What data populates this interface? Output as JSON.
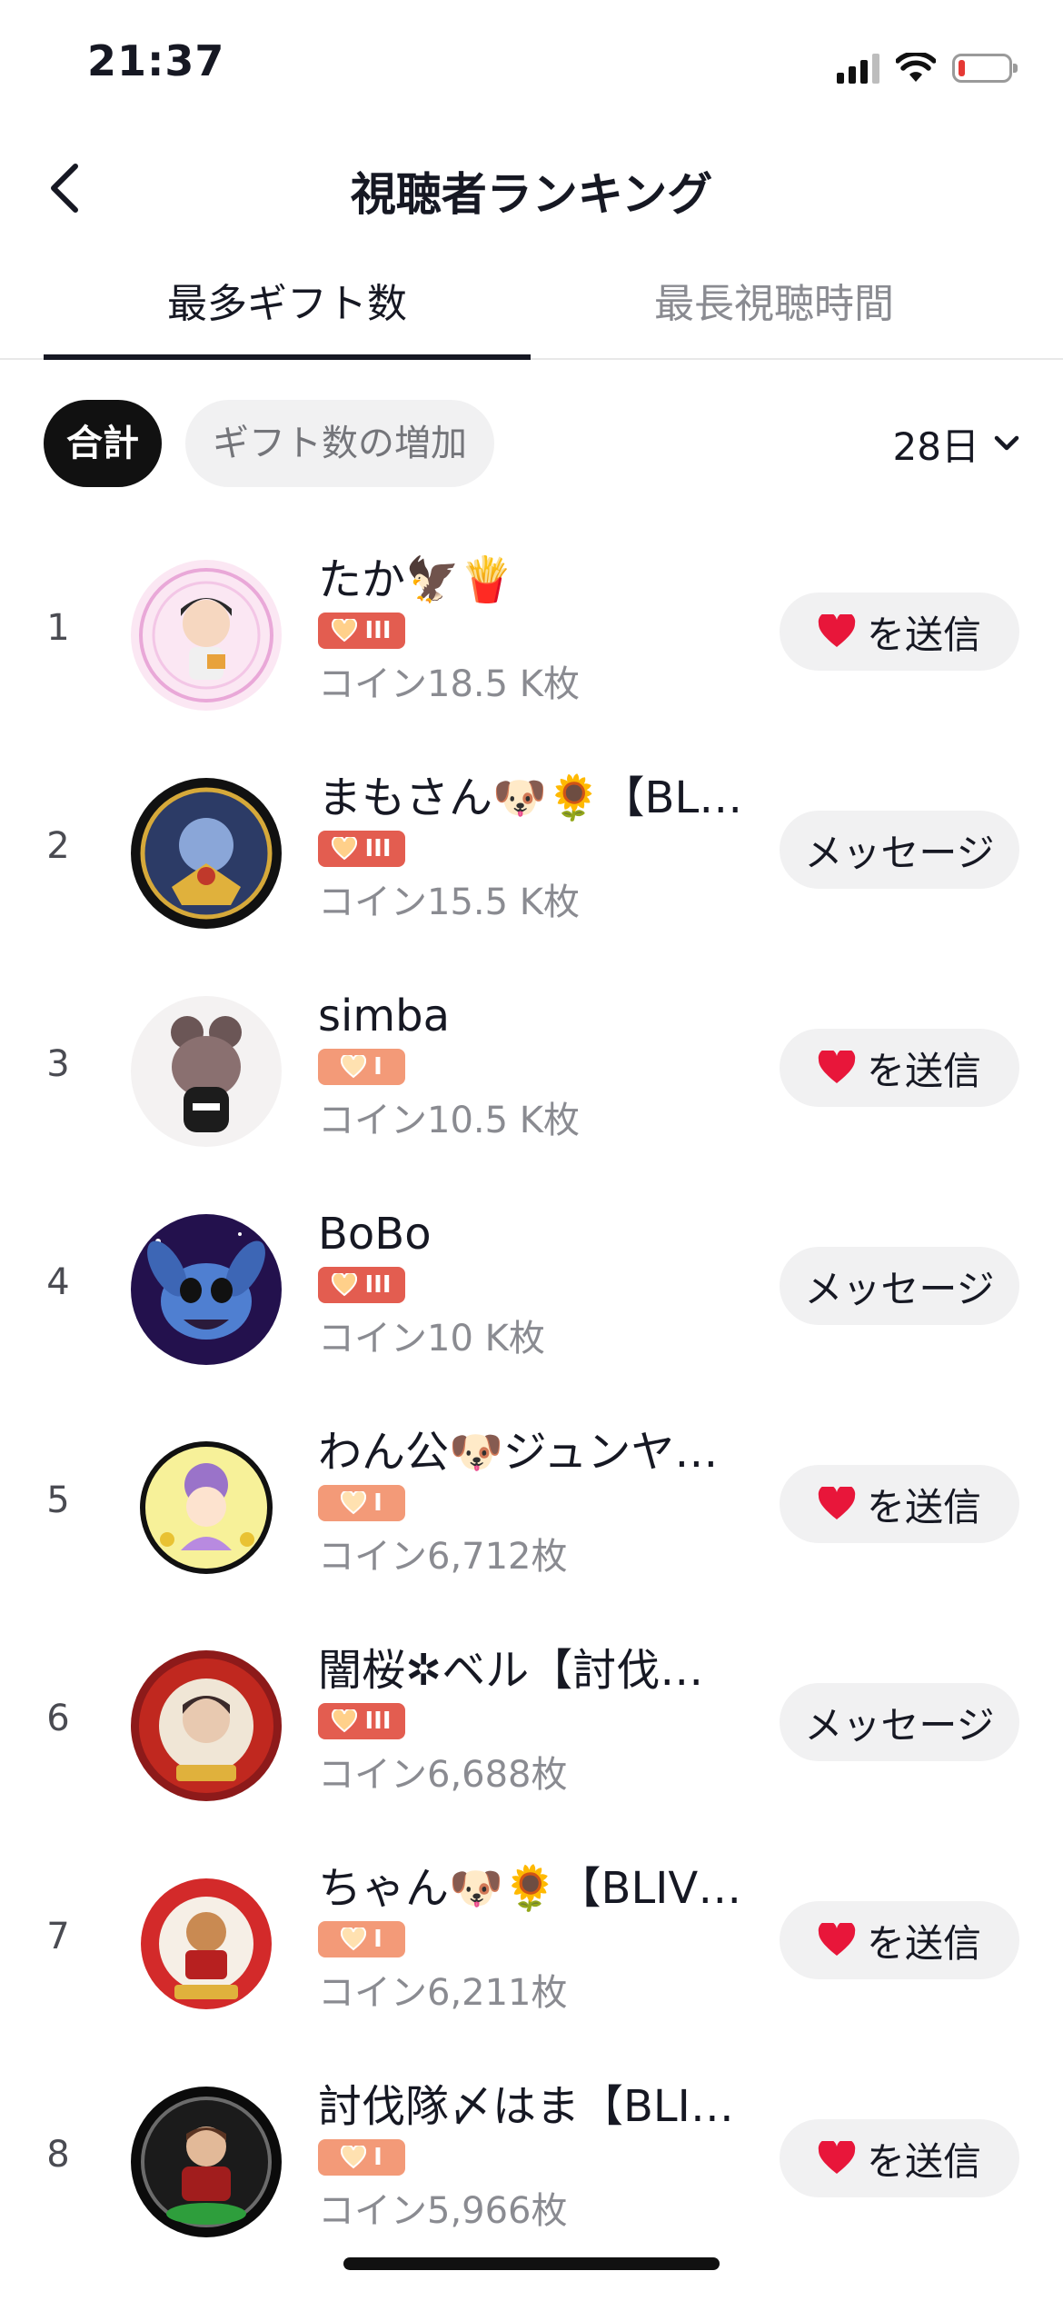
{
  "status_bar": {
    "time": "21:37"
  },
  "nav": {
    "title": "視聴者ランキング"
  },
  "tabs": [
    {
      "label": "最多ギフト数",
      "active": true
    },
    {
      "label": "最長視聴時間",
      "active": false
    }
  ],
  "filters": {
    "chips": [
      "合計",
      "ギフト数の増加"
    ],
    "period": "28日"
  },
  "actions": {
    "send_label": "を送信",
    "message_label": "メッセージ"
  },
  "colors": {
    "badge_level3": "#e35d50",
    "badge_level1": "#f39a78",
    "heart": "#e8163a"
  },
  "ranking": [
    {
      "rank": "1",
      "name": "たか🦅🍟",
      "level": "III",
      "coins": "コイン18.5 K枚",
      "action": "send"
    },
    {
      "rank": "2",
      "name": "まもさん🐶🌻【BLIV…",
      "level": "III",
      "coins": "コイン15.5 K枚",
      "action": "message"
    },
    {
      "rank": "3",
      "name": "simba",
      "level": "I",
      "coins": "コイン10.5 K枚",
      "action": "send"
    },
    {
      "rank": "4",
      "name": "BoBo",
      "level": "III",
      "coins": "コイン10 K枚",
      "action": "message"
    },
    {
      "rank": "5",
      "name": "わん公🐶ジュンヤ…",
      "level": "I",
      "coins": "コイン6,712枚",
      "action": "send"
    },
    {
      "rank": "6",
      "name": "闇桜✲ベル【討伐…",
      "level": "III",
      "coins": "コイン6,688枚",
      "action": "message"
    },
    {
      "rank": "7",
      "name": "ちゃん🐶🌻【BLIV…",
      "level": "I",
      "coins": "コイン6,211枚",
      "action": "send"
    },
    {
      "rank": "8",
      "name": "討伐隊〆はま【BLI…",
      "level": "I",
      "coins": "コイン5,966枚",
      "action": "send"
    }
  ]
}
